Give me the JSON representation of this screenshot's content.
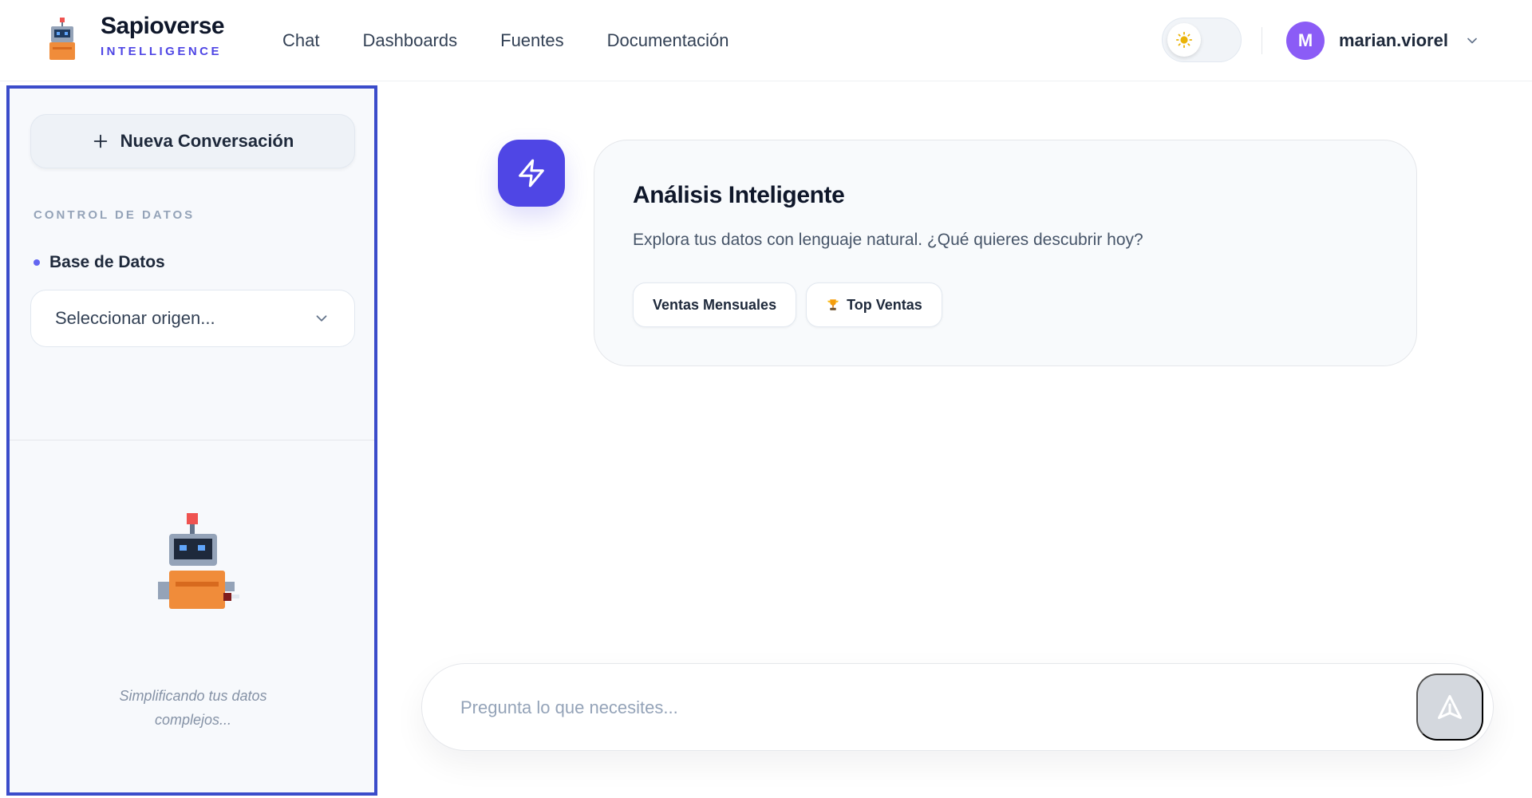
{
  "brand": {
    "name": "Sapioverse",
    "subtitle": "INTELLIGENCE"
  },
  "nav": {
    "items": [
      {
        "label": "Chat"
      },
      {
        "label": "Dashboards"
      },
      {
        "label": "Fuentes"
      },
      {
        "label": "Documentación"
      }
    ]
  },
  "user": {
    "initial": "M",
    "name": "marian.viorel"
  },
  "theme": {
    "mode_icon": "sun-icon"
  },
  "sidebar": {
    "new_conversation_label": "Nueva Conversación",
    "section_label": "CONTROL DE DATOS",
    "database_label": "Base de Datos",
    "source_select_value": "Seleccionar origen...",
    "tagline": "Simplificando tus datos complejos..."
  },
  "main": {
    "card_title": "Análisis Inteligente",
    "card_description": "Explora tus datos con lenguaje natural. ¿Qué quieres descubrir hoy?",
    "chips": [
      {
        "label": "Ventas Mensuales"
      },
      {
        "label": "Top Ventas",
        "icon": "trophy-icon"
      }
    ]
  },
  "input": {
    "placeholder": "Pregunta lo que necesites..."
  },
  "colors": {
    "accent": "#4f46e5",
    "avatar": "#8b5cf6",
    "highlight_border": "#3b4cca",
    "mascot_body": "#f08c3a"
  }
}
